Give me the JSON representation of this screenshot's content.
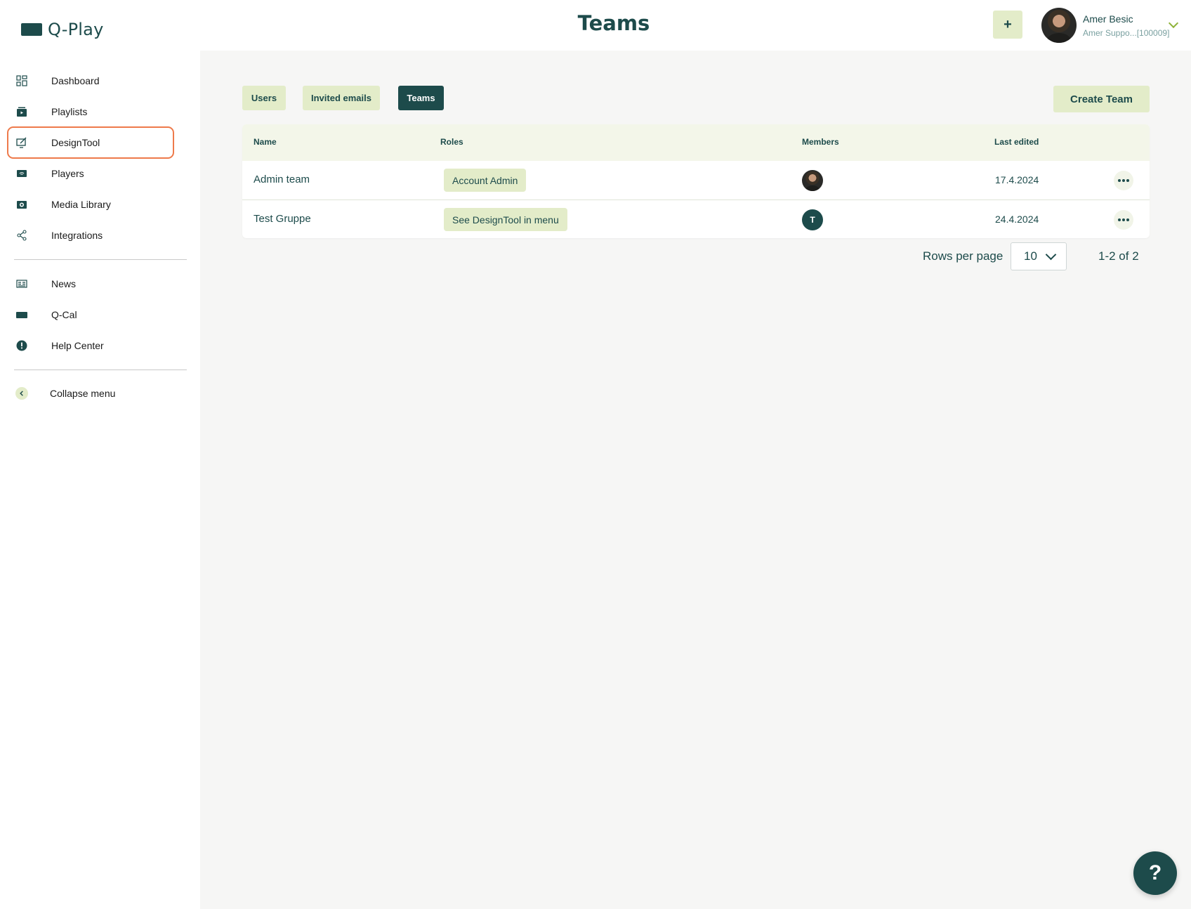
{
  "app": {
    "name": "Q-Play"
  },
  "header": {
    "title": "Teams",
    "add_label": "+",
    "user": {
      "name": "Amer Besic",
      "subtitle": "Amer Suppo...[100009]"
    }
  },
  "sidebar": {
    "items": [
      {
        "label": "Dashboard",
        "icon": "dashboard-icon"
      },
      {
        "label": "Playlists",
        "icon": "playlist-icon"
      },
      {
        "label": "DesignTool",
        "icon": "designtool-icon",
        "active": true
      },
      {
        "label": "Players",
        "icon": "player-icon"
      },
      {
        "label": "Media Library",
        "icon": "media-library-icon"
      },
      {
        "label": "Integrations",
        "icon": "share-icon"
      }
    ],
    "secondary": [
      {
        "label": "News",
        "icon": "news-icon"
      },
      {
        "label": "Q-Cal",
        "icon": "calendar-icon"
      },
      {
        "label": "Help Center",
        "icon": "info-icon"
      }
    ],
    "collapse_label": "Collapse menu"
  },
  "tabs": [
    {
      "label": "Users",
      "active": false
    },
    {
      "label": "Invited emails",
      "active": false
    },
    {
      "label": "Teams",
      "active": true
    }
  ],
  "create_button": "Create Team",
  "table": {
    "columns": [
      "Name",
      "Roles",
      "Members",
      "Last edited"
    ],
    "rows": [
      {
        "name": "Admin team",
        "role": "Account Admin",
        "member": "photo",
        "last_edited": "17.4.2024"
      },
      {
        "name": "Test Gruppe",
        "role": "See DesignTool in menu",
        "member": "T",
        "last_edited": "24.4.2024"
      }
    ]
  },
  "pagination": {
    "rows_per_page_label": "Rows per page",
    "rows_per_page": "10",
    "range": "1-2 of 2"
  },
  "help_fab": "?",
  "colors": {
    "primary": "#1d4b4b",
    "accent_light": "#e3ecc9",
    "highlight": "#ee7a4b"
  }
}
